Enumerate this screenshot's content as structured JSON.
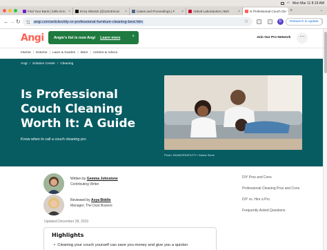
{
  "menubar": {
    "datetime": "Mon Mar 11  8:19 AM"
  },
  "tabs": [
    {
      "label": "Find Your Bank | Zelle Erro",
      "favicon_color": "#6d1ed4"
    },
    {
      "label": "Erica Wissick (@1101Ericwi",
      "favicon_color": "#111111"
    },
    {
      "label": "Cases and Proceedings | F",
      "favicon_color": "#4a6a8a"
    },
    {
      "label": "Abbott Laboratories | Beh",
      "favicon_color": "#c8102e"
    },
    {
      "label": "Is Professional Couch Cle",
      "favicon_color": "#ff6153",
      "active": true
    }
  ],
  "toolbar": {
    "url": "angi.com/articles/diy-or-professional-furniture-cleaning-best.htm",
    "profile_initial": "E",
    "relaunch_label": "Relaunch to update"
  },
  "site": {
    "logo": "Angi",
    "toast_message": "Angie's list is now Angi",
    "toast_link": "Learn more",
    "join_pro": "Join Our Pro Network",
    "nav": [
      "Interior",
      "Exterior",
      "Lawn & Garden",
      "More",
      "Articles & Advice"
    ],
    "nav_separator": "|"
  },
  "hero": {
    "breadcrumb": [
      "Angi",
      "Solution Center",
      "Cleaning"
    ],
    "breadcrumb_separator": "/",
    "title": "Is Professional Couch Cleaning Worth It: A Guide",
    "subtitle": "Know when to call a couch cleaning pro",
    "photo_credit": "Photo: NDABCREATIVITY / Adobe Stock"
  },
  "authors": [
    {
      "prefix": "Written by",
      "name": "Gemma Johnstone",
      "role": "Contributing Writer"
    },
    {
      "prefix": "Reviewed by",
      "name": "Asya Biddle",
      "role": "Manager, The Dust Busters"
    }
  ],
  "updated": "Updated December 28, 2023",
  "toc": [
    "DIY Pros and Cons",
    "Professional Cleaning Pros and Cons",
    "DIY vs. Hire a Pro",
    "Frequently Asked Questions"
  ],
  "highlights": {
    "title": "Highlights",
    "bullet": "Cleaning your couch yourself can save you money and give you a quicker"
  },
  "colors": {
    "brand": "#ff6153",
    "hero_bg": "#075c62",
    "toast_bg": "#1f7a3f"
  }
}
